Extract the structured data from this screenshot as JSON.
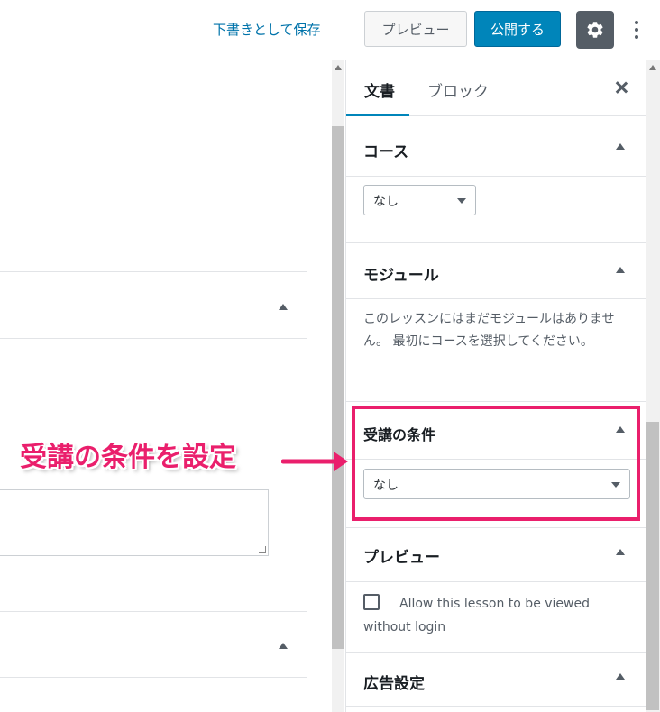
{
  "toolbar": {
    "save_draft": "下書きとして保存",
    "preview": "プレビュー",
    "publish": "公開する",
    "settings_icon": "gear-icon",
    "more_icon": "vertical-ellipsis-icon"
  },
  "sidebar": {
    "tabs": [
      {
        "label": "文書",
        "active": true
      },
      {
        "label": "ブロック",
        "active": false
      }
    ],
    "close_icon": "close-icon",
    "panels": {
      "course": {
        "title": "コース",
        "select_value": "なし"
      },
      "module": {
        "title": "モジュール",
        "message": "このレッスンにはまだモジュールはありません。 最初にコースを選択してください。"
      },
      "prerequisite": {
        "title": "受講の条件",
        "select_value": "なし"
      },
      "preview": {
        "title": "プレビュー",
        "checkbox_label": "Allow this lesson to be viewed without login",
        "checked": false
      },
      "ads": {
        "title": "広告設定"
      }
    }
  },
  "annotation": {
    "text": "受講の条件を設定",
    "color": "#ea1f6c"
  },
  "colors": {
    "accent": "#0085ba",
    "link": "#0073aa",
    "settings_bg": "#555d66"
  }
}
